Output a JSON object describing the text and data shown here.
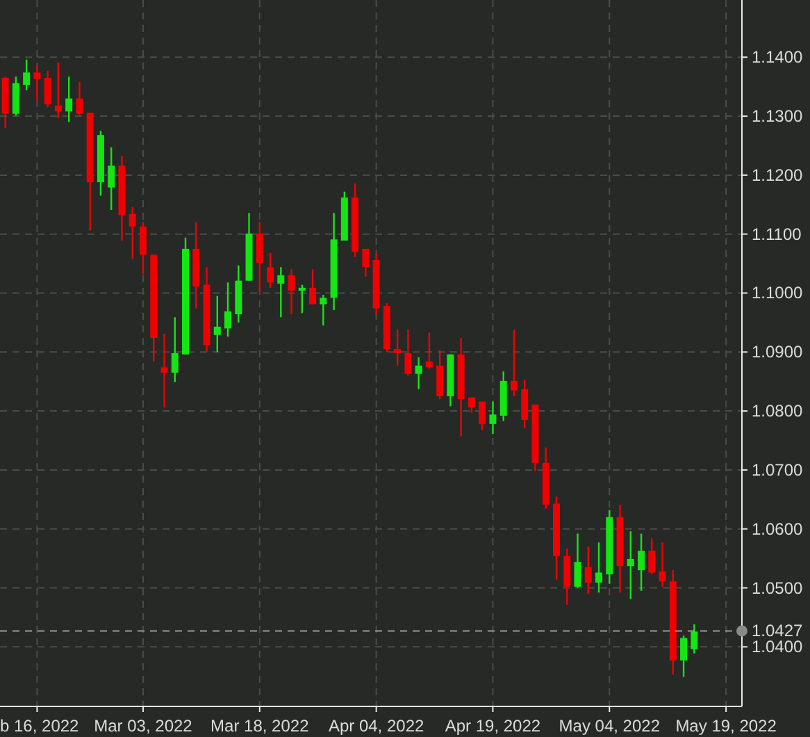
{
  "chart": {
    "chart_data": {
      "type": "candlestick",
      "categories": [
        null,
        null,
        null,
        "b 16, 2022",
        null,
        null,
        null,
        null,
        null,
        null,
        null,
        null,
        null,
        "Mar 03, 2022",
        null,
        null,
        null,
        null,
        null,
        null,
        null,
        null,
        null,
        null,
        "Mar 18, 2022",
        null,
        null,
        null,
        null,
        null,
        null,
        null,
        null,
        null,
        null,
        "Apr 04, 2022",
        null,
        null,
        null,
        null,
        null,
        null,
        null,
        null,
        null,
        null,
        "Apr 19, 2022",
        null,
        null,
        null,
        null,
        null,
        null,
        null,
        null,
        null,
        null,
        "May 04, 2022",
        null,
        null,
        null,
        null,
        null,
        null,
        null,
        null,
        null,
        null,
        "May 19, 2022",
        null
      ],
      "ohlc": [
        [
          1.1365,
          1.1367,
          1.128,
          1.1304
        ],
        [
          1.1304,
          1.1367,
          1.1301,
          1.1356
        ],
        [
          1.1353,
          1.1396,
          1.1344,
          1.1374
        ],
        [
          1.1374,
          1.1386,
          1.1325,
          1.1363
        ],
        [
          1.1365,
          1.1377,
          1.1315,
          1.132
        ],
        [
          1.1318,
          1.1391,
          1.1297,
          1.1308
        ],
        [
          1.1308,
          1.1367,
          1.129,
          1.133
        ],
        [
          1.133,
          1.1358,
          1.1301,
          1.1304
        ],
        [
          1.1306,
          1.1306,
          1.1106,
          1.1188
        ],
        [
          1.1188,
          1.1275,
          1.1165,
          1.1268
        ],
        [
          1.1179,
          1.1247,
          1.1141,
          1.1216
        ],
        [
          1.1216,
          1.1233,
          1.1089,
          1.1132
        ],
        [
          1.1134,
          1.1146,
          1.1058,
          1.1113
        ],
        [
          1.1113,
          1.112,
          1.1032,
          1.1065
        ],
        [
          1.1065,
          1.1065,
          1.0884,
          1.0924
        ],
        [
          1.0874,
          1.0931,
          1.0806,
          1.0865
        ],
        [
          1.0865,
          1.0959,
          1.0849,
          1.0898
        ],
        [
          1.0896,
          1.1094,
          1.0896,
          1.1075
        ],
        [
          1.1075,
          1.112,
          1.0974,
          1.1011
        ],
        [
          1.1014,
          1.1044,
          1.09,
          1.0912
        ],
        [
          1.0929,
          1.0995,
          1.09,
          1.0943
        ],
        [
          1.094,
          1.1018,
          1.0926,
          1.0969
        ],
        [
          1.0964,
          1.1047,
          1.095,
          1.1021
        ],
        [
          1.1021,
          1.1136,
          1.1021,
          1.1101
        ],
        [
          1.1101,
          1.112,
          1.1002,
          1.1051
        ],
        [
          1.1044,
          1.1068,
          1.1009,
          1.1018
        ],
        [
          1.1016,
          1.1044,
          1.0959,
          1.103
        ],
        [
          1.103,
          1.104,
          1.0964,
          1.1004
        ],
        [
          1.1004,
          1.1014,
          1.0966,
          1.1009
        ],
        [
          1.1009,
          1.104,
          1.0981,
          1.0981
        ],
        [
          1.0981,
          1.0997,
          1.0945,
          1.0992
        ],
        [
          1.0992,
          1.1136,
          1.0971,
          1.1091
        ],
        [
          1.1089,
          1.1172,
          1.1089,
          1.1162
        ],
        [
          1.1162,
          1.1186,
          1.1061,
          1.107
        ],
        [
          1.1075,
          1.1075,
          1.1028,
          1.1044
        ],
        [
          1.1056,
          1.1068,
          1.0962,
          1.0974
        ],
        [
          1.0978,
          1.0983,
          1.09,
          1.0905
        ],
        [
          1.0905,
          1.0938,
          1.0877,
          1.0898
        ],
        [
          1.0898,
          1.0938,
          1.086,
          1.0863
        ],
        [
          1.0863,
          1.0891,
          1.0837,
          1.0877
        ],
        [
          1.0884,
          1.0933,
          1.0872,
          1.0874
        ],
        [
          1.0877,
          1.0903,
          1.082,
          1.0825
        ],
        [
          1.0825,
          1.0896,
          1.0808,
          1.0896
        ],
        [
          1.0896,
          1.0924,
          1.0757,
          1.082
        ],
        [
          1.0823,
          1.0823,
          1.0797,
          1.0806
        ],
        [
          1.0816,
          1.0816,
          1.0768,
          1.0778
        ],
        [
          1.0778,
          1.0816,
          1.0761,
          1.0794
        ],
        [
          1.0792,
          1.0867,
          1.0783,
          1.0851
        ],
        [
          1.0851,
          1.0938,
          1.0825,
          1.0835
        ],
        [
          1.0837,
          1.0853,
          1.0771,
          1.0785
        ],
        [
          1.0811,
          1.0811,
          1.0698,
          1.0712
        ],
        [
          1.0712,
          1.0738,
          1.0634,
          1.0641
        ],
        [
          1.0643,
          1.0655,
          1.0514,
          1.0554
        ],
        [
          1.0554,
          1.0566,
          1.0471,
          1.0502
        ],
        [
          1.0502,
          1.0592,
          1.05,
          1.0544
        ],
        [
          1.0535,
          1.057,
          1.049,
          1.0509
        ],
        [
          1.0509,
          1.0577,
          1.0492,
          1.0526
        ],
        [
          1.0523,
          1.0632,
          1.0507,
          1.062
        ],
        [
          1.062,
          1.0641,
          1.0492,
          1.0537
        ],
        [
          1.0537,
          1.0596,
          1.0481,
          1.0549
        ],
        [
          1.053,
          1.0592,
          1.0495,
          1.0563
        ],
        [
          1.0563,
          1.0584,
          1.0523,
          1.0526
        ],
        [
          1.0528,
          1.0577,
          1.0502,
          1.0511
        ],
        [
          1.0511,
          1.053,
          1.0353,
          1.0377
        ],
        [
          1.0377,
          1.0419,
          1.0349,
          1.0415
        ],
        [
          1.0396,
          1.0438,
          1.0389,
          1.0426
        ],
        null,
        null,
        null,
        null
      ],
      "ylim": [
        1.0299,
        1.1497
      ],
      "grid": true,
      "ref_lines": [
        {
          "axis": "y",
          "value": 1.0427,
          "label": "1.0427"
        }
      ],
      "yticks": [
        {
          "value": 1.14,
          "label": "1.1400"
        },
        {
          "value": 1.13,
          "label": "1.1300"
        },
        {
          "value": 1.12,
          "label": "1.1200"
        },
        {
          "value": 1.11,
          "label": "1.1100"
        },
        {
          "value": 1.1,
          "label": "1.1000"
        },
        {
          "value": 1.09,
          "label": "1.0900"
        },
        {
          "value": 1.08,
          "label": "1.0800"
        },
        {
          "value": 1.07,
          "label": "1.0700"
        },
        {
          "value": 1.06,
          "label": "1.0600"
        },
        {
          "value": 1.05,
          "label": "1.0500"
        },
        {
          "value": 1.04,
          "label": "1.0400"
        }
      ]
    }
  }
}
